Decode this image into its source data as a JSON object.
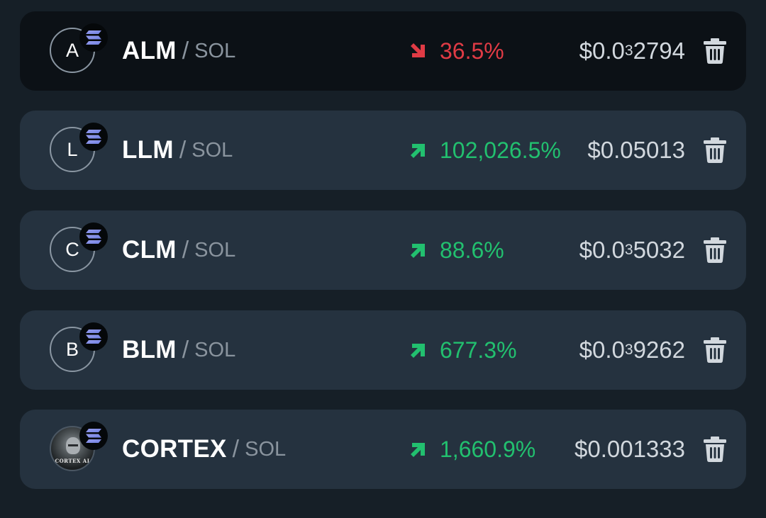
{
  "colors": {
    "background": "#161f27",
    "row": "#25323f",
    "row_active": "#0c1116",
    "up": "#22c06f",
    "down": "#e03b45",
    "price": "#d2d8de",
    "muted": "#8a949e"
  },
  "pairs": [
    {
      "avatar_letter": "A",
      "base": "ALM",
      "separator": "/",
      "quote": "SOL",
      "chain_icon": "solana-icon",
      "direction": "down",
      "change": "36.5%",
      "price_prefix": "$0.0",
      "price_zeros": "3",
      "price_digits": "2794",
      "delete_icon": "trash-icon"
    },
    {
      "avatar_letter": "L",
      "base": "LLM",
      "separator": "/",
      "quote": "SOL",
      "chain_icon": "solana-icon",
      "direction": "up",
      "change": "102,026.5%",
      "price_prefix": "$0.05013",
      "price_zeros": "",
      "price_digits": "",
      "delete_icon": "trash-icon"
    },
    {
      "avatar_letter": "C",
      "base": "CLM",
      "separator": "/",
      "quote": "SOL",
      "chain_icon": "solana-icon",
      "direction": "up",
      "change": "88.6%",
      "price_prefix": "$0.0",
      "price_zeros": "3",
      "price_digits": "5032",
      "delete_icon": "trash-icon"
    },
    {
      "avatar_letter": "B",
      "base": "BLM",
      "separator": "/",
      "quote": "SOL",
      "chain_icon": "solana-icon",
      "direction": "up",
      "change": "677.3%",
      "price_prefix": "$0.0",
      "price_zeros": "3",
      "price_digits": "9262",
      "delete_icon": "trash-icon"
    },
    {
      "avatar_letter": "",
      "avatar_caption": "CORTEX AI",
      "base": "CORTEX",
      "separator": "/",
      "quote": "SOL",
      "chain_icon": "solana-icon",
      "direction": "up",
      "change": "1,660.9%",
      "price_prefix": "$0.001333",
      "price_zeros": "",
      "price_digits": "",
      "delete_icon": "trash-icon"
    }
  ]
}
